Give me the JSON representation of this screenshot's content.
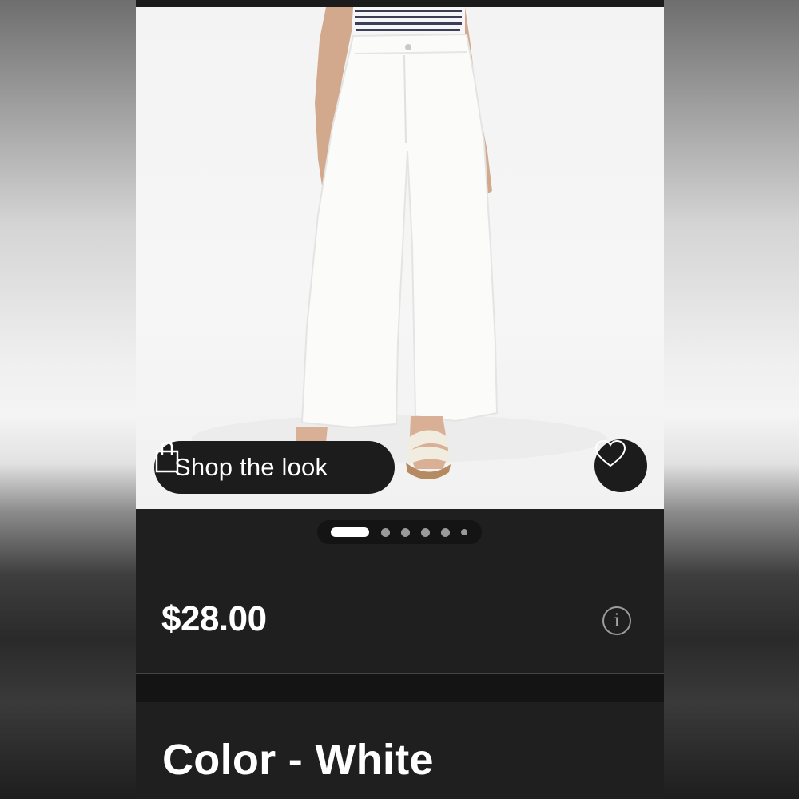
{
  "product": {
    "image_alt": "White wide-leg jeans",
    "shop_button_label": "Shop the look",
    "price": "$28.00",
    "color_label": "Color - White"
  },
  "carousel": {
    "total": 6,
    "active_index": 0
  },
  "icons": {
    "shop": "shopping-bag-icon",
    "favorite": "heart-icon",
    "info": "info-icon"
  },
  "colors": {
    "panel_bg": "#1f1f1f",
    "button_bg": "#1c1c1c",
    "text": "#ffffff"
  }
}
